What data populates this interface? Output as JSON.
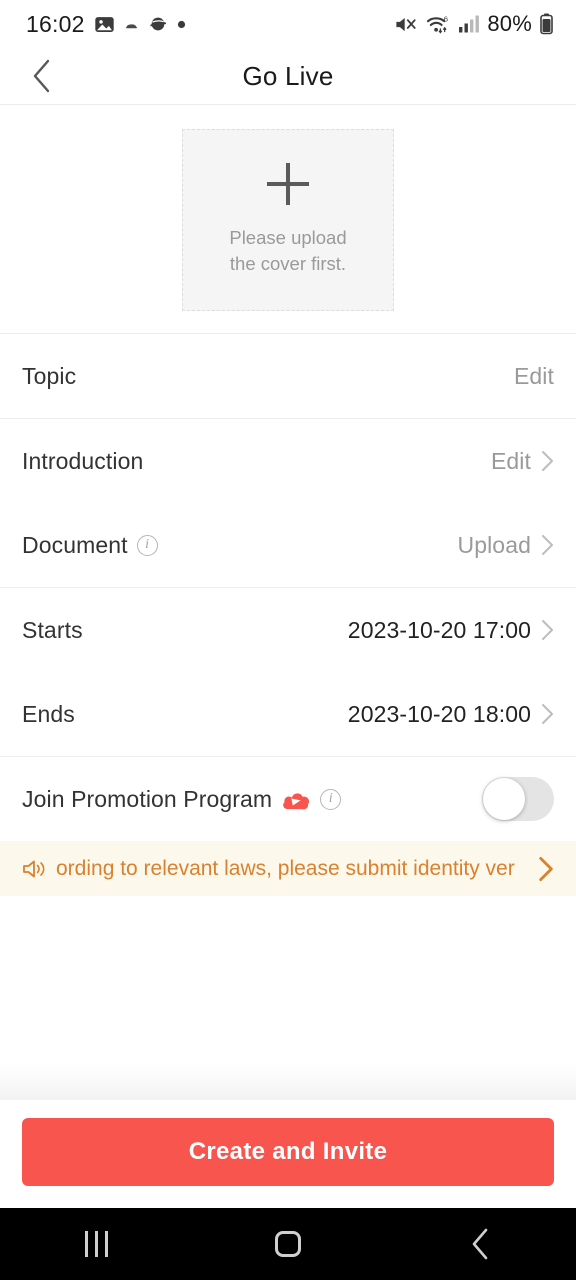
{
  "status_bar": {
    "time": "16:02",
    "battery_text": "80%",
    "left_icons": [
      "photo-icon",
      "notification-dot-icon",
      "app-icon",
      "dot-icon"
    ],
    "right_icons": [
      "mute-icon",
      "wifi-6-icon",
      "cellular-signal-icon",
      "battery-icon"
    ]
  },
  "header": {
    "title": "Go Live",
    "back_icon": "chevron-left-icon"
  },
  "cover": {
    "plus_icon": "plus-icon",
    "hint_line1": "Please upload",
    "hint_line2": "the cover first."
  },
  "rows": {
    "topic": {
      "label": "Topic",
      "action": "Edit"
    },
    "introduction": {
      "label": "Introduction",
      "action": "Edit",
      "chevron": "chevron-right-icon"
    },
    "document": {
      "label": "Document",
      "info_icon": "info-icon",
      "action": "Upload",
      "chevron": "chevron-right-icon"
    },
    "starts": {
      "label": "Starts",
      "value": "2023-10-20 17:00",
      "chevron": "chevron-right-icon"
    },
    "ends": {
      "label": "Ends",
      "value": "2023-10-20 18:00",
      "chevron": "chevron-right-icon"
    },
    "promotion": {
      "label": "Join Promotion Program",
      "badge_icon": "promotion-cloud-icon",
      "info_icon": "info-icon",
      "toggle_state": "off"
    }
  },
  "banner": {
    "speaker_icon": "speaker-icon",
    "text": "ording to relevant laws, please submit identity ver",
    "chevron": "chevron-right-icon",
    "background": "#fdf8ec",
    "text_color": "#d9812f"
  },
  "cta": {
    "label": "Create and Invite",
    "color": "#f8554f"
  },
  "navbar": {
    "recents_icon": "recents-icon",
    "home_icon": "home-icon",
    "back_icon": "nav-back-icon"
  }
}
